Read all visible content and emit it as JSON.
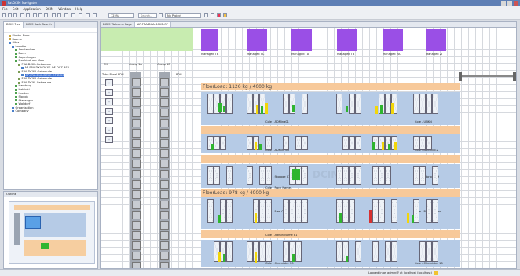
{
  "window": {
    "title": "FatDCIM Navigator"
  },
  "menu": [
    "File",
    "Edit",
    "Application",
    "DCIM",
    "Window",
    "Help"
  ],
  "toolbar": {
    "zoom": "125%",
    "search_placeholder": "Search...",
    "project": "No Project"
  },
  "left_panel": {
    "tabs": [
      "DCIM Tree",
      "DCIM Rack Search"
    ],
    "tree": [
      {
        "label": "Master Data",
        "level": 1,
        "icon": "folder-icon",
        "color": "#c9a640"
      },
      {
        "label": "Rooms",
        "level": 1,
        "icon": "folder-icon",
        "color": "#c9a640"
      },
      {
        "label": "Sites",
        "level": 1,
        "icon": "globe-icon",
        "color": "#4a7fc9"
      },
      {
        "label": "Location",
        "level": 2,
        "icon": "globe-icon",
        "color": "#4a7fc9"
      },
      {
        "label": "Amsterdam",
        "level": 3,
        "icon": "building-icon",
        "color": "#4ea24e"
      },
      {
        "label": "Bonn",
        "level": 3,
        "icon": "building-icon",
        "color": "#4ea24e"
      },
      {
        "label": "Copenhagen",
        "level": 3,
        "icon": "building-icon",
        "color": "#4ea24e"
      },
      {
        "label": "Frankfurt am Main",
        "level": 3,
        "icon": "building-icon",
        "color": "#4ea24e"
      },
      {
        "label": "FRA-DCXL-Gebaeude",
        "level": 4,
        "icon": "building-icon",
        "color": "#7b9c55"
      },
      {
        "label": "AP-FRA-DXA-DCXE-OF-DCZ.RS4",
        "level": 5,
        "icon": "room-icon",
        "color": "#4a7fc9"
      },
      {
        "label": "FRA-DCXD-Gebaeude",
        "level": 4,
        "icon": "building-icon",
        "color": "#7b9c55"
      },
      {
        "label": "AP-FRA-DXA-DCXE-OF-DCM",
        "level": 5,
        "icon": "room-icon",
        "color": "#4a7fc9",
        "selected": true
      },
      {
        "label": "FRA-DCXD-Gebaeude",
        "level": 4,
        "icon": "building-icon",
        "color": "#7b9c55"
      },
      {
        "label": "FRA-DCXL-Gebaeude",
        "level": 4,
        "icon": "building-icon",
        "color": "#7b9c55"
      },
      {
        "label": "Hamburg",
        "level": 3,
        "icon": "building-icon",
        "color": "#4ea24e"
      },
      {
        "label": "Helsinki",
        "level": 3,
        "icon": "building-icon",
        "color": "#4ea24e"
      },
      {
        "label": "London",
        "level": 3,
        "icon": "building-icon",
        "color": "#4ea24e"
      },
      {
        "label": "Slough",
        "level": 3,
        "icon": "building-icon",
        "color": "#4ea24e"
      },
      {
        "label": "Stavanger",
        "level": 3,
        "icon": "building-icon",
        "color": "#4ea24e"
      },
      {
        "label": "Walldorf",
        "level": 3,
        "icon": "building-icon",
        "color": "#4ea24e"
      },
      {
        "label": "Organization",
        "level": 2,
        "icon": "org-icon",
        "color": "#4a7fc9"
      },
      {
        "label": "Company",
        "level": 2,
        "icon": "org-icon",
        "color": "#4a7fc9"
      }
    ]
  },
  "outline_panel": {
    "title": "Outline"
  },
  "editor": {
    "tabs": [
      "DCIM Welcome Page",
      "AP-FRA-DXA-DCXE-OF"
    ],
    "top_labels": [
      "Managed I B",
      "Managed I C",
      "Managed I A",
      "Managed I B",
      "Managed 2A",
      "Managed 2I"
    ],
    "column_labels": [
      "CH",
      "Group 1A",
      "Group 1B"
    ],
    "pdu_labels": [
      "Tube Panel",
      "PDU"
    ],
    "floor_loads": [
      "FloorLoad: 1126 kg / 4000 kg",
      "FloorLoad: 978 kg / 4000 kg"
    ],
    "row_labels": [
      "Cole - ADMina01",
      "Cole - UNKN",
      "Cole - ADMini 03",
      "Cole - ADMini E2",
      "Cole - Storage 87",
      "Cole - Storage 89",
      "Cole - Rack Name",
      "Cole - Free Option",
      "Cole - Roche Name",
      "Cole - Admin Name 81",
      "Cole - Chemister 20",
      "Cole - Chemister 18"
    ],
    "cell_label": "Rack\nPNG001"
  },
  "status": {
    "text": "Logged in as admin@ at localhost (localhost)"
  },
  "colors": {
    "purple": "#9a4fe6",
    "orange": "#f7c99a",
    "blue_zone": "#b6cbe6",
    "green_unit": "#2fb52f",
    "yellow_unit": "#f2d60a",
    "red_unit": "#d83131"
  }
}
